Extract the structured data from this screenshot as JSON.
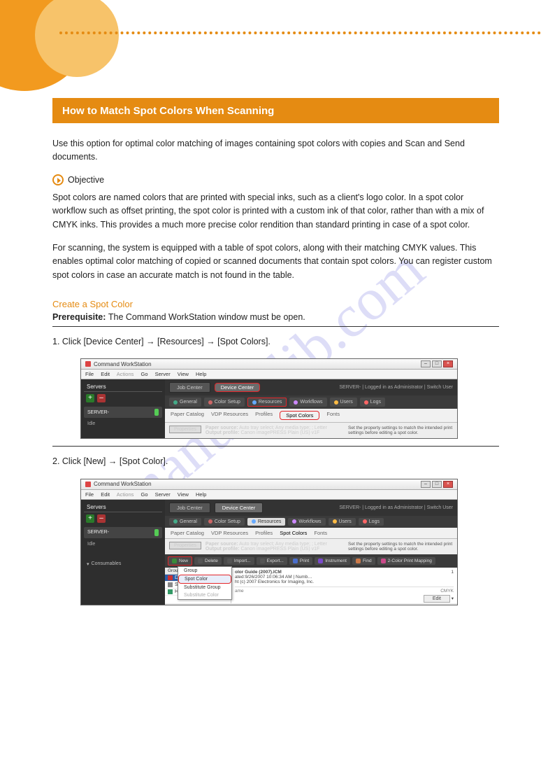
{
  "ribbon_title": "How to Match Spot Colors When Scanning",
  "intro": "Use this option for optimal color matching of images containing spot colors with copies and Scan and Send documents.",
  "arrow_label": "Objective",
  "paragraph1": "Spot colors are named colors that are printed with special inks, such as a client's logo color. In a spot color workflow such as offset printing, the spot color is printed with a custom ink of that color, rather than with a mix of CMYK inks. This provides a much more precise color rendition than standard printing in case of a spot color.",
  "paragraph2": "For scanning, the system is equipped with a table of spot colors, along with their matching CMYK values. This enables optimal color matching of copied or scanned documents that contain spot colors. You can register custom spot colors in case an accurate match is not found in the table.",
  "section_create": {
    "title": "Create a Spot Color",
    "sub_bold": "Prerequisite: ",
    "sub_rest": "The Command WorkStation window must be open.",
    "step1": "1. Click [Device Center] → [Resources] → [Spot Colors].",
    "step2": "2. Click [New] → [Spot Color]."
  },
  "cws": {
    "title": "Command WorkStation",
    "menu": {
      "file": "File",
      "edit": "Edit",
      "actions": "Actions",
      "go": "Go",
      "server": "Server",
      "view": "View",
      "help": "Help"
    },
    "win": {
      "min": "–",
      "max": "□",
      "close": "×"
    },
    "tabs": {
      "job_center": "Job Center",
      "device_center": "Device Center"
    },
    "right_status": "SERVER-           | Logged in as Administrator | Switch User",
    "iconrow": {
      "general": "General",
      "color_setup": "Color Setup",
      "resources": "Resources",
      "workflows": "Workflows",
      "users": "Users",
      "logs": "Logs"
    },
    "subtabs": {
      "paper_catalog": "Paper Catalog",
      "vdp_resources": "VDP Resources",
      "profiles": "Profiles",
      "spot_colors": "Spot Colors",
      "fonts": "Fonts"
    },
    "side": {
      "header": "Servers",
      "server_label": "SERVER-",
      "idle": "Idle",
      "consumables": "Consumables"
    },
    "props": {
      "btn": "Properties",
      "source_lbl": "Paper source:",
      "source_val": "Auto tray select; Any media type; ; Letter",
      "profile_lbl": "Output profile:",
      "profile_val": "Canon imagePRESS          Plain (US) v1F",
      "hint": "Set the property settings to match the intended print settings before editing a spot color."
    },
    "btnbar": {
      "new": "New",
      "delete": "Delete",
      "import": "Import...",
      "export": "Export...",
      "print": "Print",
      "instrument": "Instrument",
      "find": "Find",
      "twocolor": "2-Color Print Mapping"
    },
    "groups": {
      "head": "Group Name",
      "g1": "DIC Co",
      "g2": "System",
      "g3": "HKS E (C"
    },
    "popup": {
      "group": "Group",
      "spot": "Spot Color",
      "subgroup": "Substitute Group",
      "subcolor": "Substitute Color"
    },
    "rightpane": {
      "title": "olor Guide (2007).ICM",
      "line1": "ated:9/26/2007 10:06:34 AM | Numb…",
      "line2": "ht (c) 2007 Electronics for Imaging, Inc.",
      "one": "1",
      "cmyk": "CMYK",
      "name_col": "ame",
      "edit": "Edit"
    }
  },
  "watermark": "manualslib.com"
}
